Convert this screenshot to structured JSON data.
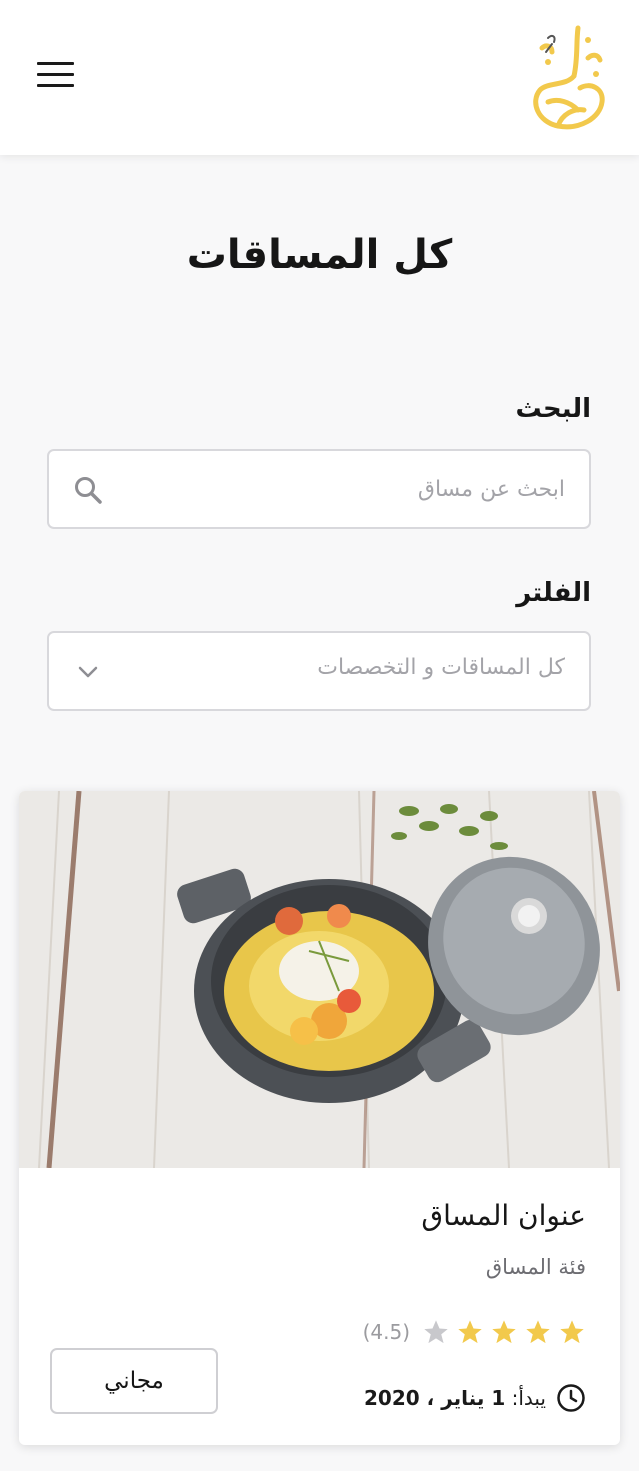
{
  "header": {
    "menu_icon": "hamburger-icon",
    "logo_icon": "calligraphy-logo-icon",
    "logo_color": "#f2c94c"
  },
  "page": {
    "title": "كل المساقات"
  },
  "search": {
    "label": "البحث",
    "placeholder": "ابحث عن مساق",
    "value": "",
    "icon": "search-icon"
  },
  "filter": {
    "label": "الفلتر",
    "selected": "كل المساقات و التخصصات",
    "icon": "chevron-down-icon"
  },
  "course_card": {
    "image_icon": "food-pot-image",
    "title": "عنوان المساق",
    "category": "فئة المساق",
    "rating": 4.5,
    "rating_text": "(4.5)",
    "stars_filled": 4,
    "stars_total": 5,
    "star_color": "#f2c94c",
    "price_label": "مجاني",
    "start_prefix": "يبدأ:",
    "start_date": "1 يناير ، 2020",
    "clock_icon": "clock-icon"
  }
}
